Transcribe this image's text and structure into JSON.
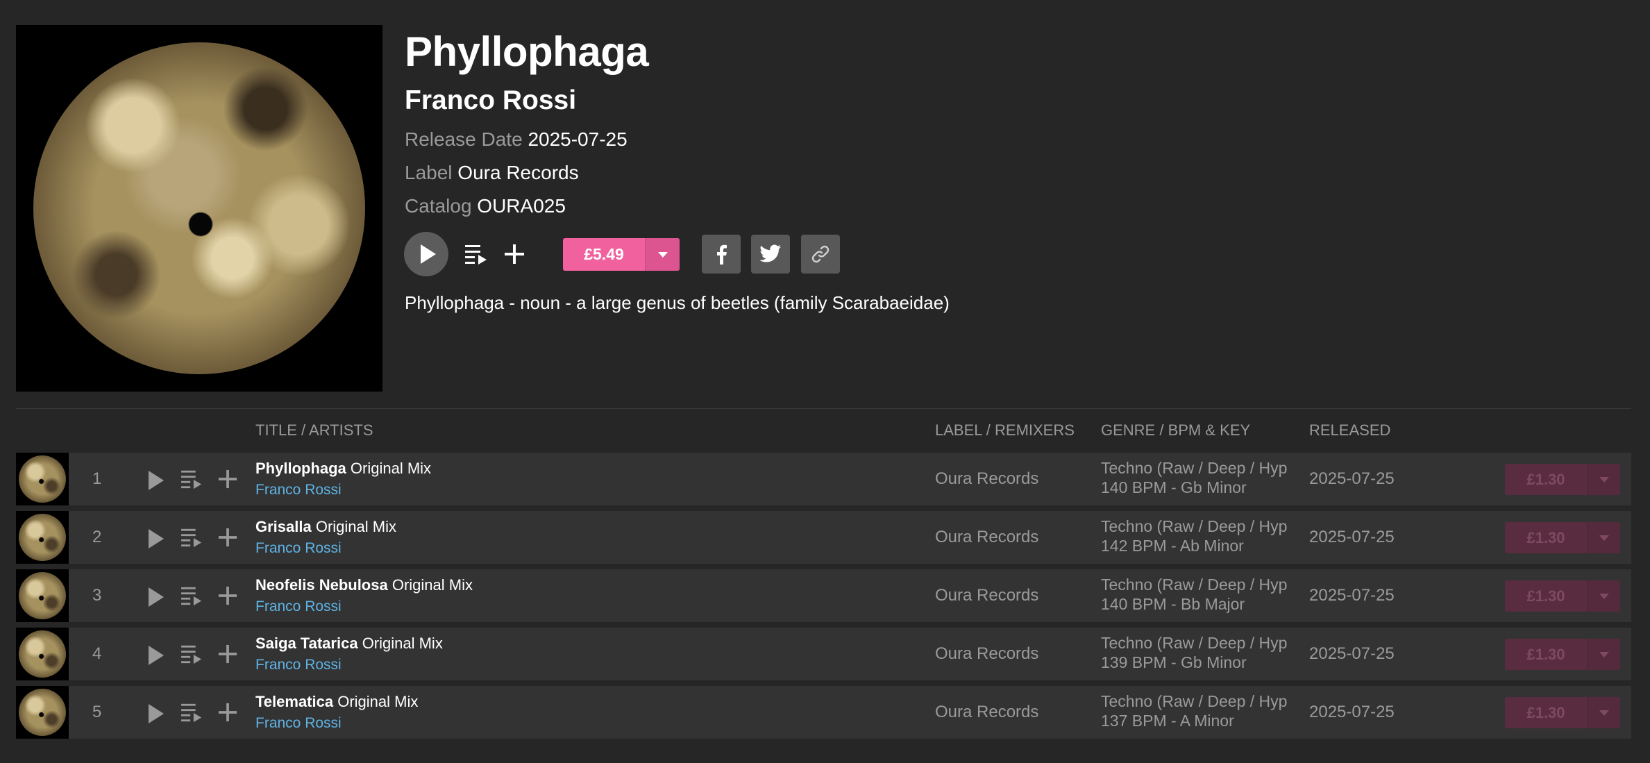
{
  "release": {
    "title": "Phyllophaga",
    "artist": "Franco Rossi",
    "release_date_label": "Release Date",
    "release_date": "2025-07-25",
    "label_label": "Label",
    "label": "Oura Records",
    "catalog_label": "Catalog",
    "catalog": "OURA025",
    "price": "£5.49",
    "description": "Phyllophaga - noun - a large genus of beetles (family Scarabaeidae)"
  },
  "icons": {
    "play": "play-icon",
    "queue": "add-to-queue-icon",
    "add": "plus-icon",
    "dropdown": "chevron-down-icon",
    "facebook": "facebook-icon",
    "twitter": "twitter-icon",
    "link": "link-icon"
  },
  "colors": {
    "background": "#262626",
    "row_background": "#333333",
    "accent": "#f0619e",
    "artist_link": "#5fb3e4",
    "muted_text": "#9a9a9a"
  },
  "table": {
    "headers": {
      "title": "TITLE / ARTISTS",
      "label": "LABEL / REMIXERS",
      "genre": "GENRE / BPM & KEY",
      "released": "RELEASED"
    },
    "rows": [
      {
        "num": "1",
        "name": "Phyllophaga",
        "mix": "Original Mix",
        "artist": "Franco Rossi",
        "label": "Oura Records",
        "genre": "Techno (Raw / Deep / Hypnotic)",
        "bpm_key": "140 BPM - Gb Minor",
        "released": "2025-07-25",
        "price": "£1.30"
      },
      {
        "num": "2",
        "name": "Grisalla",
        "mix": "Original Mix",
        "artist": "Franco Rossi",
        "label": "Oura Records",
        "genre": "Techno (Raw / Deep / Hypnotic)",
        "bpm_key": "142 BPM - Ab Minor",
        "released": "2025-07-25",
        "price": "£1.30"
      },
      {
        "num": "3",
        "name": "Neofelis Nebulosa",
        "mix": "Original Mix",
        "artist": "Franco Rossi",
        "label": "Oura Records",
        "genre": "Techno (Raw / Deep / Hypnotic)",
        "bpm_key": "140 BPM - Bb Major",
        "released": "2025-07-25",
        "price": "£1.30"
      },
      {
        "num": "4",
        "name": "Saiga Tatarica",
        "mix": "Original Mix",
        "artist": "Franco Rossi",
        "label": "Oura Records",
        "genre": "Techno (Raw / Deep / Hypnotic)",
        "bpm_key": "139 BPM - Gb Minor",
        "released": "2025-07-25",
        "price": "£1.30"
      },
      {
        "num": "5",
        "name": "Telematica",
        "mix": "Original Mix",
        "artist": "Franco Rossi",
        "label": "Oura Records",
        "genre": "Techno (Raw / Deep / Hypnotic)",
        "bpm_key": "137 BPM - A Minor",
        "released": "2025-07-25",
        "price": "£1.30"
      }
    ]
  }
}
